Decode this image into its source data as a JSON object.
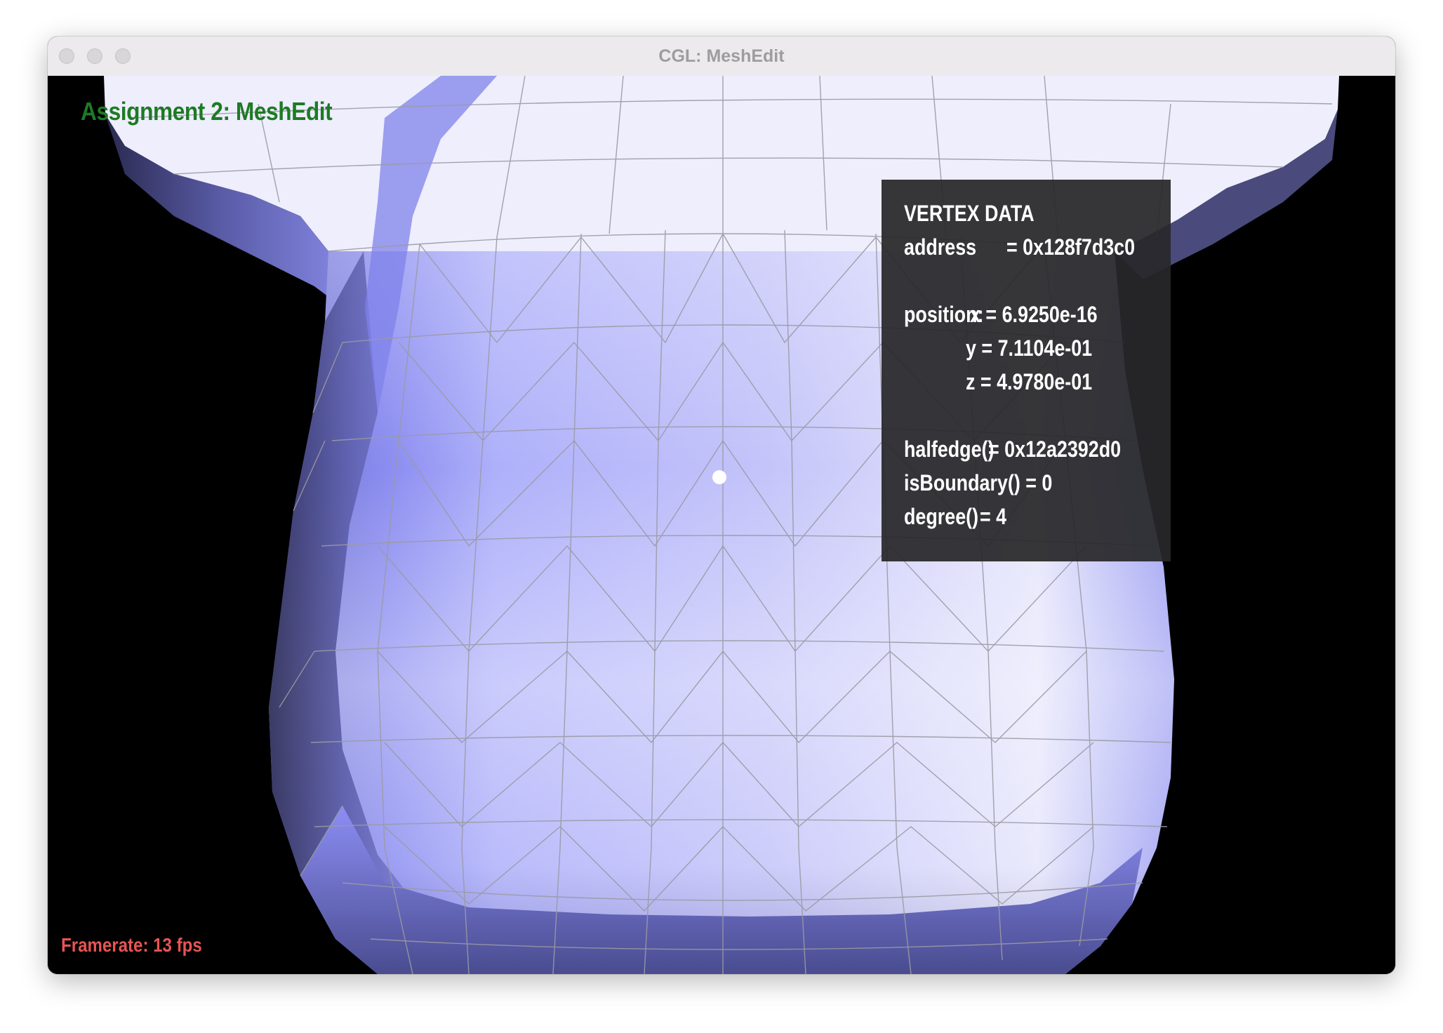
{
  "window": {
    "title": "CGL: MeshEdit"
  },
  "overlay": {
    "app_title": "Assignment 2: MeshEdit",
    "framerate": "Framerate: 13 fps"
  },
  "vertex_data": {
    "heading": "VERTEX DATA",
    "address_label": "address",
    "address_value": "= 0x128f7d3c0",
    "position_label": "position:",
    "x": "x = 6.9250e-16",
    "y": "y = 7.1104e-01",
    "z": "z = 4.9780e-01",
    "halfedge_label": "halfedge()",
    "halfedge_value": "= 0x12a2392d0",
    "isboundary": "isBoundary() = 0",
    "degree_label": "degree()",
    "degree_value": "= 4"
  },
  "colors": {
    "mesh_light": "#e4e4fc",
    "mesh_mid": "#aeb0fa",
    "mesh_dark": "#3a3a6e",
    "wire": "#9a9aa4",
    "app_title": "#1e7a24",
    "framerate": "#e85454"
  }
}
